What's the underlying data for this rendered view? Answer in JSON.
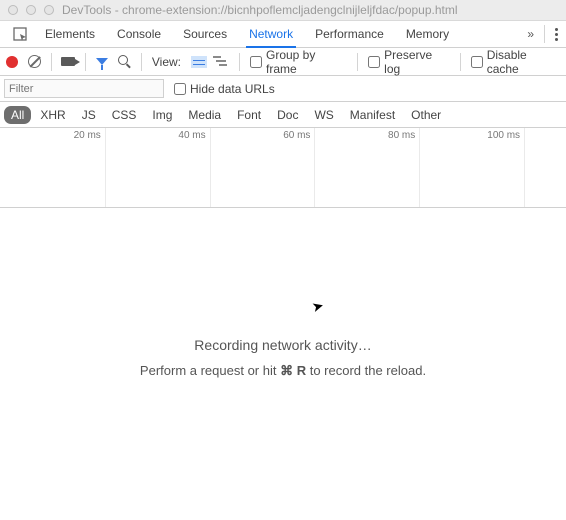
{
  "window": {
    "title": "DevTools - chrome-extension://bicnhpoflemcljadengclnijleljfdac/popup.html"
  },
  "tabs": {
    "items": [
      "Elements",
      "Console",
      "Sources",
      "Network",
      "Performance",
      "Memory"
    ],
    "active": "Network"
  },
  "toolbar": {
    "view_label": "View:",
    "group_by_frame": "Group by frame",
    "preserve_log": "Preserve log",
    "disable_cache": "Disable cache"
  },
  "filter": {
    "placeholder": "Filter",
    "hide_data_urls": "Hide data URLs"
  },
  "types": {
    "items": [
      "All",
      "XHR",
      "JS",
      "CSS",
      "Img",
      "Media",
      "Font",
      "Doc",
      "WS",
      "Manifest",
      "Other"
    ],
    "selected": "All"
  },
  "timeline": {
    "ticks": [
      "20 ms",
      "40 ms",
      "60 ms",
      "80 ms",
      "100 ms"
    ]
  },
  "empty": {
    "line1": "Recording network activity…",
    "line2_before": "Perform a request or hit ",
    "line2_keys": "⌘ R",
    "line2_after": " to record the reload."
  }
}
